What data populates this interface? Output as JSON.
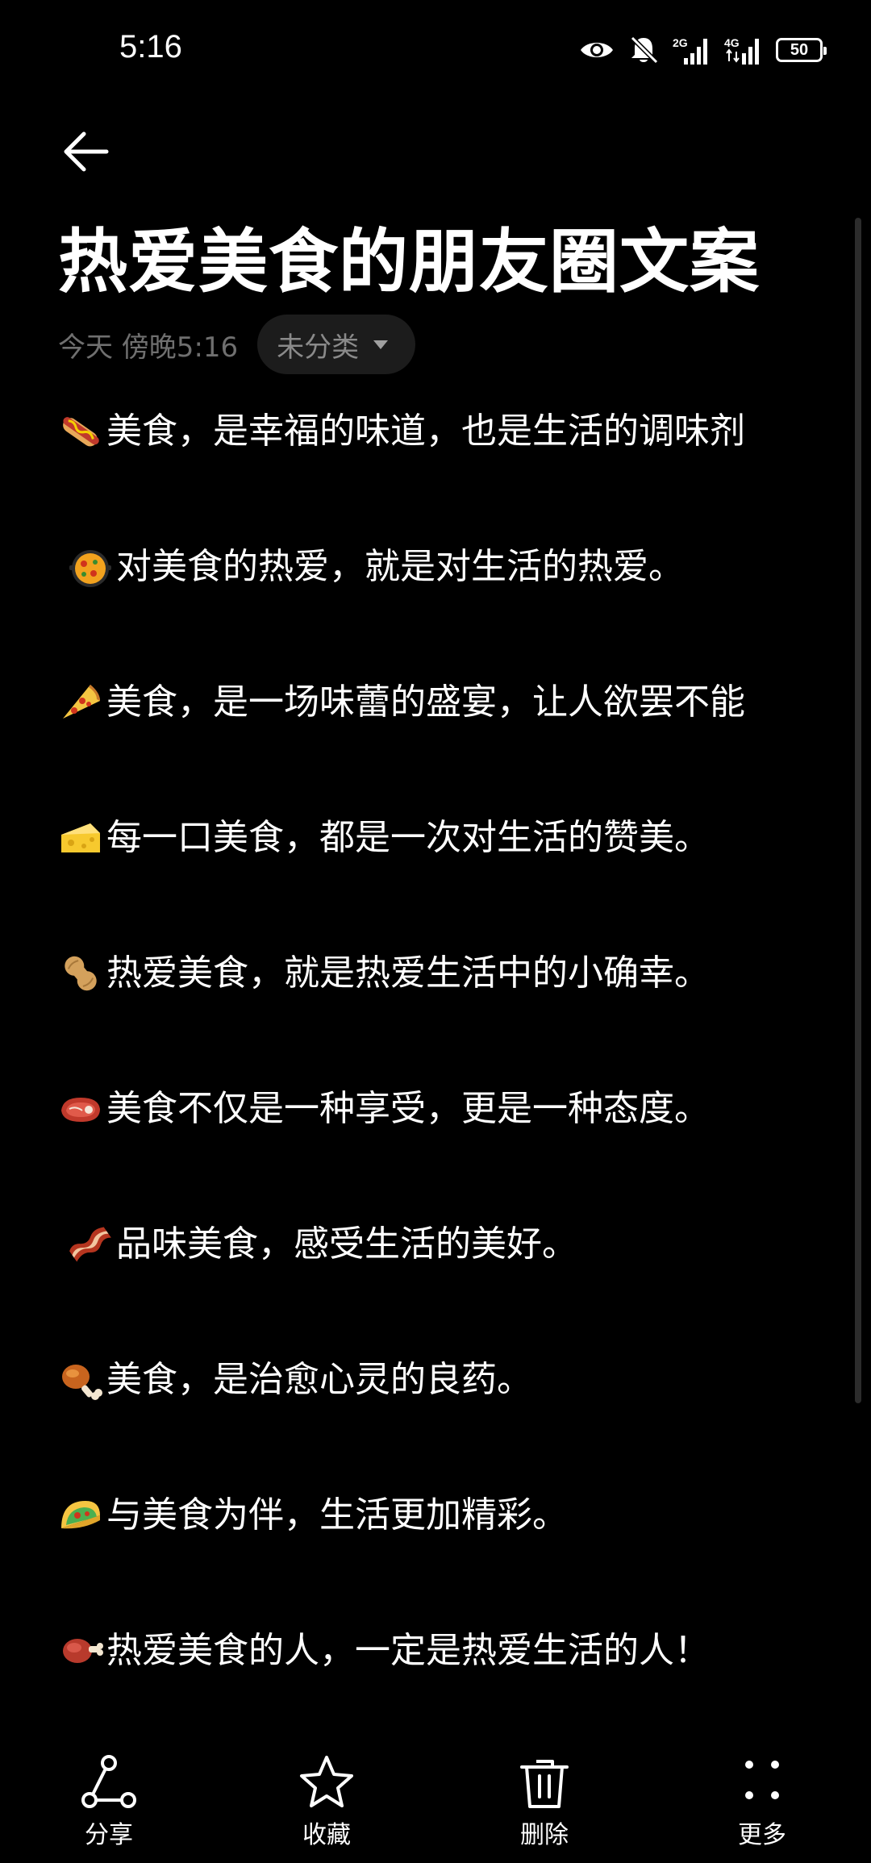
{
  "status_bar": {
    "time": "5:16",
    "network_1": "2G",
    "network_2": "4G",
    "battery": "50",
    "icons": [
      "eye-icon",
      "bell-muted-icon",
      "signal-icon",
      "signal-icon",
      "battery-icon"
    ]
  },
  "header": {
    "back_icon": "arrow-left-icon",
    "title": "热爱美食的朋友圈文案",
    "date": "今天 傍晚5:16",
    "category": "未分类",
    "category_icon": "caret-down-icon"
  },
  "lines": [
    {
      "emoji": "hotdog-emoji",
      "text": "美食，是幸福的味道，也是生活的调味剂"
    },
    {
      "emoji": "paella-emoji",
      "text": "对美食的热爱，就是对生活的热爱。"
    },
    {
      "emoji": "pizza-emoji",
      "text": "美食，是一场味蕾的盛宴，让人欲罢不能"
    },
    {
      "emoji": "cheese-emoji",
      "text": "每一口美食，都是一次对生活的赞美。"
    },
    {
      "emoji": "peanut-emoji",
      "text": "热爱美食，就是热爱生活中的小确幸。"
    },
    {
      "emoji": "steak-emoji",
      "text": "美食不仅是一种享受，更是一种态度。"
    },
    {
      "emoji": "bacon-emoji",
      "text": "品味美食，感受生活的美好。"
    },
    {
      "emoji": "drumstick-emoji",
      "text": " 美食，是治愈心灵的良药。"
    },
    {
      "emoji": "taco-emoji",
      "text": "与美食为伴，生活更加精彩。"
    },
    {
      "emoji": "meat-on-bone-emoji",
      "text": "热爱美食的人，一定是热爱生活的人！"
    }
  ],
  "toolbar": {
    "share": "分享",
    "favorite": "收藏",
    "delete": "删除",
    "more": "更多"
  },
  "colors": {
    "background": "#000000",
    "text": "#ffffff",
    "meta": "#6f6f6f",
    "chip_bg": "#1c1c1c"
  }
}
